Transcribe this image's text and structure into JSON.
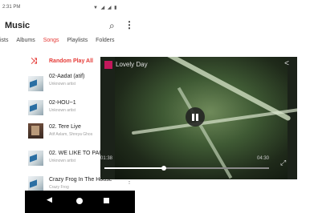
{
  "status": {
    "time": "2:31 PM"
  },
  "app": {
    "title": "Music"
  },
  "tabs": [
    {
      "label": "tists"
    },
    {
      "label": "Albums"
    },
    {
      "label": "Songs",
      "active": true
    },
    {
      "label": "Playlists"
    },
    {
      "label": "Folders"
    }
  ],
  "random_play": {
    "label": "Random Play All"
  },
  "songs": [
    {
      "title": "02-Aadat (atif)",
      "artist": "Unknown artist",
      "thumb": "album-art"
    },
    {
      "title": "02-HOU~1",
      "artist": "Unknown artist",
      "thumb": "album-art"
    },
    {
      "title": "02. Tere Liye",
      "artist": "Atif Aslam, Shreya Ghos",
      "thumb": "photo"
    },
    {
      "title": "02. WE LIKE TO PAR",
      "artist": "Unknown artist",
      "thumb": "album-art"
    },
    {
      "title": "Crazy Frog In The House",
      "artist": "Crazy Frog",
      "thumb": "album-art"
    }
  ],
  "video": {
    "title": "Lovely Day",
    "current_time": "01:38",
    "duration": "04:30",
    "progress": 0.36
  },
  "icons": {
    "search": "search-icon",
    "menu": "more-vert-icon",
    "shuffle": "shuffle-icon",
    "share": "share-icon",
    "pause": "pause-icon",
    "fullscreen": "fullscreen-icon"
  },
  "colors": {
    "accent": "#e53935",
    "navbar": "#000000"
  }
}
